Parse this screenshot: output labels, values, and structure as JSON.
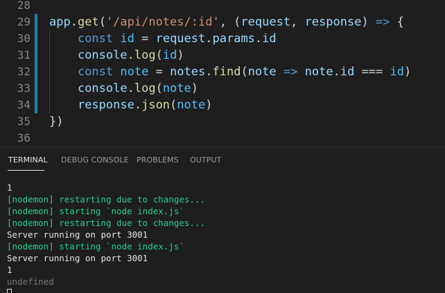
{
  "editor": {
    "lines": [
      {
        "number": "28",
        "tokens": []
      },
      {
        "number": "29",
        "tokens": [
          {
            "t": "app",
            "c": "tk-var"
          },
          {
            "t": ".",
            "c": "tk-punc"
          },
          {
            "t": "get",
            "c": "tk-fn"
          },
          {
            "t": "(",
            "c": "tk-punc"
          },
          {
            "t": "'/api/notes/:id'",
            "c": "tk-str"
          },
          {
            "t": ", (",
            "c": "tk-punc"
          },
          {
            "t": "request",
            "c": "tk-var"
          },
          {
            "t": ", ",
            "c": "tk-punc"
          },
          {
            "t": "response",
            "c": "tk-var"
          },
          {
            "t": ") ",
            "c": "tk-punc"
          },
          {
            "t": "=>",
            "c": "tk-kw"
          },
          {
            "t": " {",
            "c": "tk-punc"
          }
        ]
      },
      {
        "number": "30",
        "tokens": [
          {
            "t": "    ",
            "c": "tk-punc"
          },
          {
            "t": "const",
            "c": "tk-kw"
          },
          {
            "t": " ",
            "c": "tk-punc"
          },
          {
            "t": "id",
            "c": "tk-const"
          },
          {
            "t": " = ",
            "c": "tk-op"
          },
          {
            "t": "request",
            "c": "tk-var"
          },
          {
            "t": ".",
            "c": "tk-punc"
          },
          {
            "t": "params",
            "c": "tk-var"
          },
          {
            "t": ".",
            "c": "tk-punc"
          },
          {
            "t": "id",
            "c": "tk-var"
          }
        ]
      },
      {
        "number": "31",
        "tokens": [
          {
            "t": "    ",
            "c": "tk-punc"
          },
          {
            "t": "console",
            "c": "tk-var"
          },
          {
            "t": ".",
            "c": "tk-punc"
          },
          {
            "t": "log",
            "c": "tk-fn"
          },
          {
            "t": "(",
            "c": "tk-punc"
          },
          {
            "t": "id",
            "c": "tk-const"
          },
          {
            "t": ")",
            "c": "tk-punc"
          }
        ]
      },
      {
        "number": "32",
        "tokens": [
          {
            "t": "    ",
            "c": "tk-punc"
          },
          {
            "t": "const",
            "c": "tk-kw"
          },
          {
            "t": " ",
            "c": "tk-punc"
          },
          {
            "t": "note",
            "c": "tk-const"
          },
          {
            "t": " = ",
            "c": "tk-op"
          },
          {
            "t": "notes",
            "c": "tk-var"
          },
          {
            "t": ".",
            "c": "tk-punc"
          },
          {
            "t": "find",
            "c": "tk-fn"
          },
          {
            "t": "(",
            "c": "tk-punc"
          },
          {
            "t": "note",
            "c": "tk-var"
          },
          {
            "t": " ",
            "c": "tk-punc"
          },
          {
            "t": "=>",
            "c": "tk-kw"
          },
          {
            "t": " ",
            "c": "tk-punc"
          },
          {
            "t": "note",
            "c": "tk-var"
          },
          {
            "t": ".",
            "c": "tk-punc"
          },
          {
            "t": "id",
            "c": "tk-var"
          },
          {
            "t": " === ",
            "c": "tk-op"
          },
          {
            "t": "id",
            "c": "tk-const"
          },
          {
            "t": ")",
            "c": "tk-punc"
          }
        ]
      },
      {
        "number": "33",
        "tokens": [
          {
            "t": "    ",
            "c": "tk-punc"
          },
          {
            "t": "console",
            "c": "tk-var"
          },
          {
            "t": ".",
            "c": "tk-punc"
          },
          {
            "t": "log",
            "c": "tk-fn"
          },
          {
            "t": "(",
            "c": "tk-punc"
          },
          {
            "t": "note",
            "c": "tk-const"
          },
          {
            "t": ")",
            "c": "tk-punc"
          }
        ]
      },
      {
        "number": "34",
        "tokens": [
          {
            "t": "    ",
            "c": "tk-punc"
          },
          {
            "t": "response",
            "c": "tk-var"
          },
          {
            "t": ".",
            "c": "tk-punc"
          },
          {
            "t": "json",
            "c": "tk-fn"
          },
          {
            "t": "(",
            "c": "tk-punc"
          },
          {
            "t": "note",
            "c": "tk-const"
          },
          {
            "t": ")",
            "c": "tk-punc"
          }
        ]
      },
      {
        "number": "35",
        "tokens": [
          {
            "t": "})",
            "c": "tk-punc"
          }
        ]
      },
      {
        "number": "36",
        "tokens": []
      }
    ],
    "modified_lines": [
      "29",
      "30",
      "31",
      "32",
      "33",
      "34"
    ]
  },
  "panel": {
    "tabs": [
      {
        "label": "TERMINAL",
        "active": true
      },
      {
        "label": "DEBUG CONSOLE",
        "active": false
      },
      {
        "label": "PROBLEMS",
        "active": false
      },
      {
        "label": "OUTPUT",
        "active": false
      }
    ],
    "terminal_lines": [
      {
        "text": "1",
        "style": ""
      },
      {
        "text": "[nodemon] restarting due to changes...",
        "style": "green"
      },
      {
        "text": "[nodemon] starting `node index.js`",
        "style": "green"
      },
      {
        "text": "[nodemon] restarting due to changes...",
        "style": "green"
      },
      {
        "text": "Server running on port 3001",
        "style": ""
      },
      {
        "text": "[nodemon] starting `node index.js`",
        "style": "green"
      },
      {
        "text": "Server running on port 3001",
        "style": ""
      },
      {
        "text": "1",
        "style": ""
      },
      {
        "text": "undefined",
        "style": "gray"
      }
    ]
  }
}
